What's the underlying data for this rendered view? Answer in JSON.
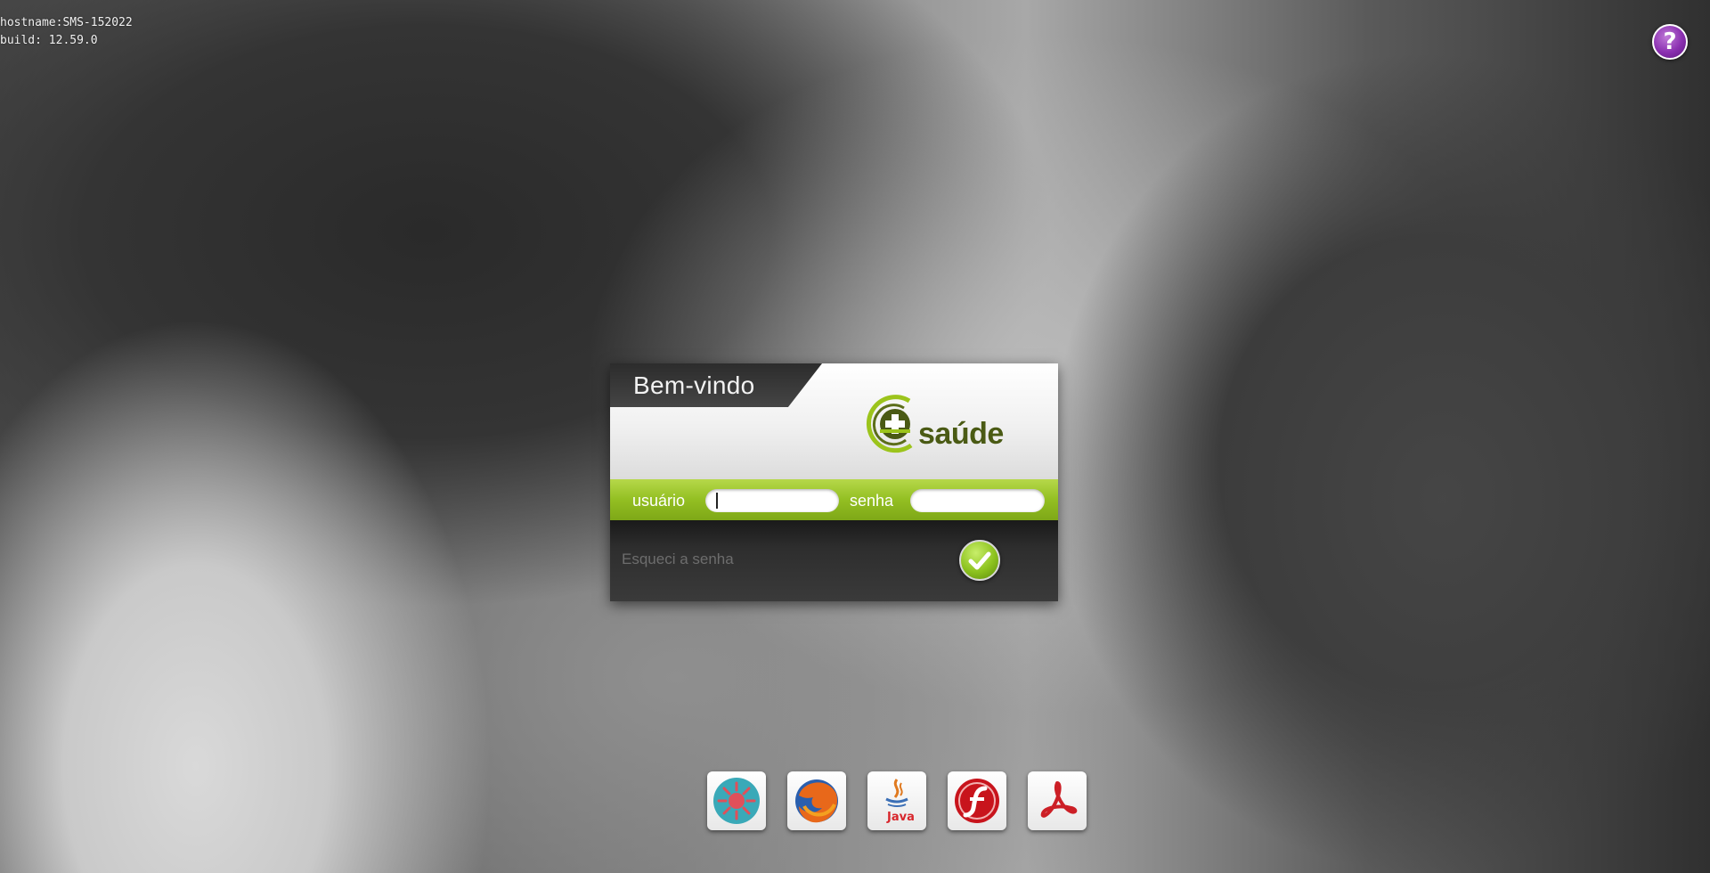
{
  "system_info": {
    "hostname_line": "hostname:SMS-152022",
    "build_line": "build: 12.59.0"
  },
  "help": {
    "icon": "help-icon",
    "label": "?"
  },
  "login": {
    "welcome": "Bem-vindo",
    "logo_text": "saúde",
    "logo_icon": "health-cross-icon",
    "username_label": "usuário",
    "username_value": "",
    "password_label": "senha",
    "password_value": "",
    "forgot_password": "Esqueci a senha",
    "submit_icon": "checkmark-icon"
  },
  "plugins": [
    {
      "name": "bug-plugin-icon"
    },
    {
      "name": "firefox-icon"
    },
    {
      "name": "java-icon",
      "label": "Java"
    },
    {
      "name": "flash-icon"
    },
    {
      "name": "acrobat-icon"
    }
  ],
  "colors": {
    "accent_green": "#93bf22",
    "logo_dark_green": "#4a5a14",
    "help_purple": "#8a2fb0",
    "panel_dark": "#2e2e2e"
  }
}
